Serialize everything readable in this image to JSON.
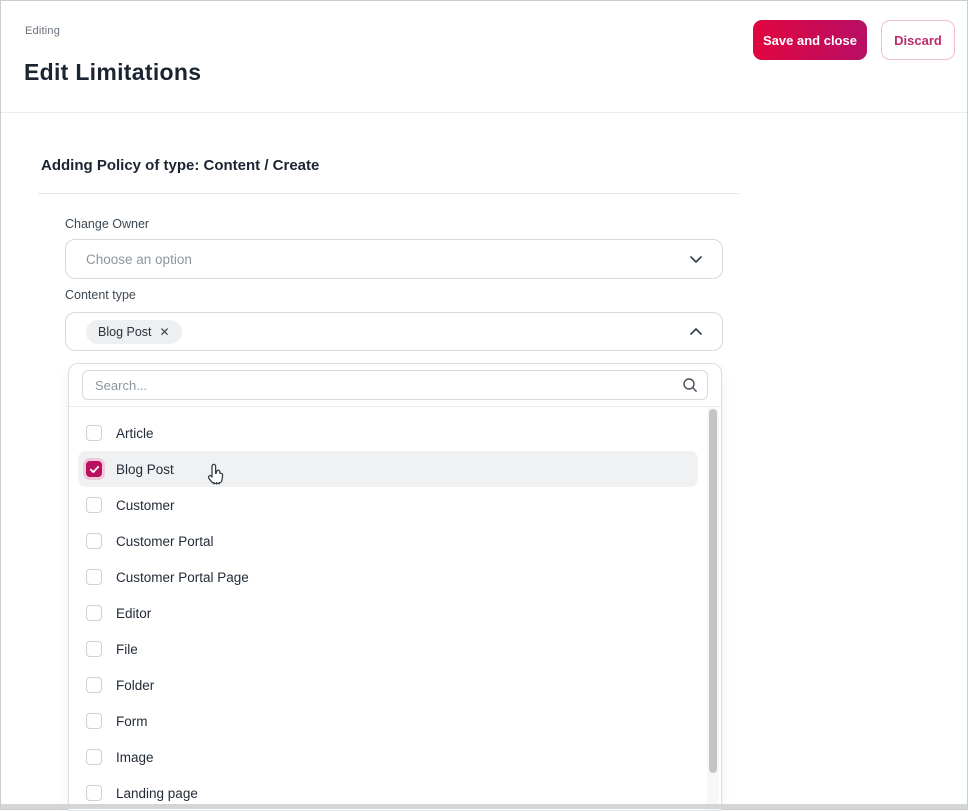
{
  "header": {
    "breadcrumb": "Editing",
    "title": "Edit Limitations",
    "save_label": "Save and close",
    "discard_label": "Discard"
  },
  "form": {
    "section_title": "Adding Policy of type: Content / Create",
    "change_owner": {
      "label": "Change Owner",
      "placeholder": "Choose an option"
    },
    "content_type": {
      "label": "Content type",
      "chips": [
        {
          "label": "Blog Post",
          "remove_icon": "✕"
        }
      ]
    },
    "dropdown": {
      "search_placeholder": "Search...",
      "options": [
        {
          "label": "Article",
          "checked": false,
          "highlighted": false
        },
        {
          "label": "Blog Post",
          "checked": true,
          "highlighted": true
        },
        {
          "label": "Customer",
          "checked": false,
          "highlighted": false
        },
        {
          "label": "Customer Portal",
          "checked": false,
          "highlighted": false
        },
        {
          "label": "Customer Portal Page",
          "checked": false,
          "highlighted": false
        },
        {
          "label": "Editor",
          "checked": false,
          "highlighted": false
        },
        {
          "label": "File",
          "checked": false,
          "highlighted": false
        },
        {
          "label": "Folder",
          "checked": false,
          "highlighted": false
        },
        {
          "label": "Form",
          "checked": false,
          "highlighted": false
        },
        {
          "label": "Image",
          "checked": false,
          "highlighted": false
        },
        {
          "label": "Landing page",
          "checked": false,
          "highlighted": false
        }
      ]
    }
  },
  "icons": {
    "chevron_down": "chevron-down",
    "chevron_up": "chevron-up",
    "search": "magnifier",
    "checkmark": "check",
    "cursor": "hand-pointer"
  },
  "colors": {
    "accent_gradient_start": "#e1063f",
    "accent_gradient_end": "#b70e66",
    "checkbox_checked": "#bb1060",
    "checkbox_halo": "#f1c9db",
    "discard_border": "#f0bcd4",
    "discard_text": "#bb2d6e",
    "row_highlight": "#f0f1f3",
    "title_text": "#1b2532",
    "muted_text": "#8d969d"
  }
}
